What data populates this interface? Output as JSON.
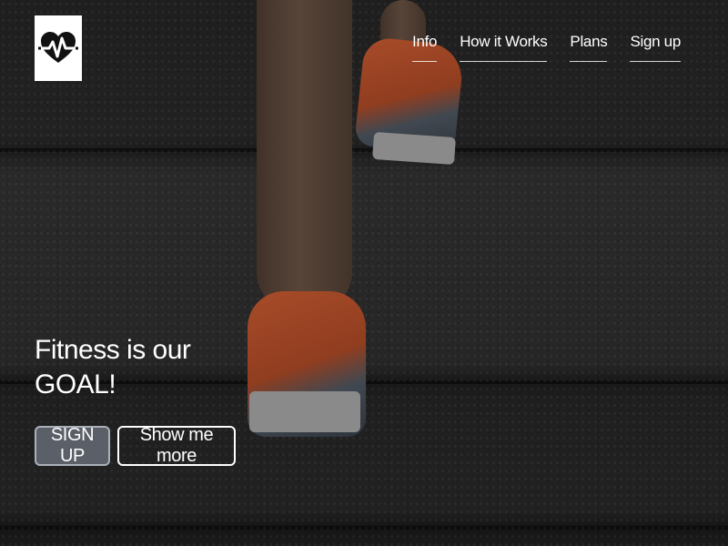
{
  "brand": {
    "logo_icon": "heartbeat-icon",
    "logo_bg": "#ffffff"
  },
  "nav": {
    "items": [
      {
        "label": "Info"
      },
      {
        "label": "How it Works"
      },
      {
        "label": "Plans"
      },
      {
        "label": "Sign up"
      }
    ]
  },
  "hero": {
    "title_line1": "Fitness is our",
    "title_line2": "GOAL!",
    "primary_button": "SIGN UP",
    "secondary_button": "Show me more"
  },
  "colors": {
    "primary_button_bg": "#5b6068",
    "text": "#ffffff"
  }
}
